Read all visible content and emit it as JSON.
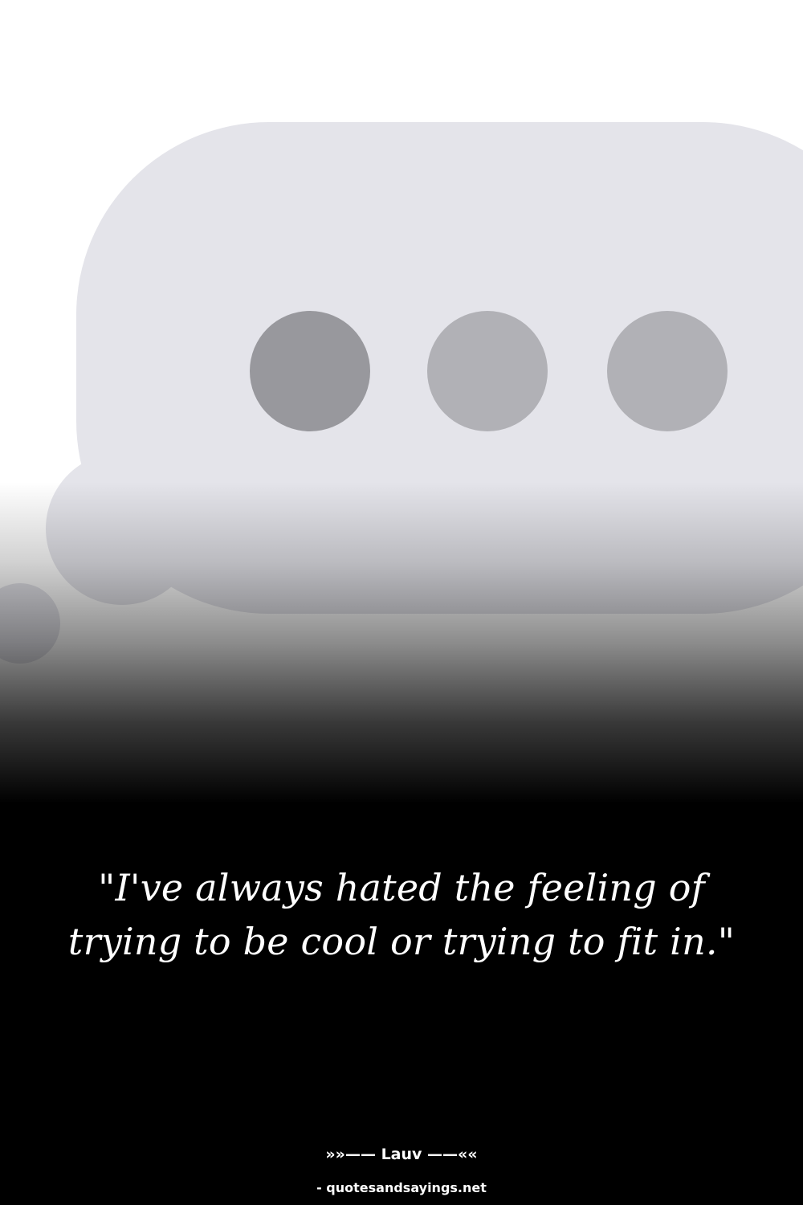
{
  "image": {
    "icon": "thought-bubble-typing-indicator",
    "colors": {
      "background_top": "#ffffff",
      "bubble": "#e4e4ea",
      "dot_dark": "#98989d",
      "dot_light": "#b1b1b6",
      "background_bottom": "#000000"
    }
  },
  "quote": {
    "text": "\"I've always hated the feeling of trying to be cool or trying to fit in.\""
  },
  "author": {
    "text": "»»—— Lauv ——««"
  },
  "source": {
    "text": "- quotesandsayings.net"
  }
}
